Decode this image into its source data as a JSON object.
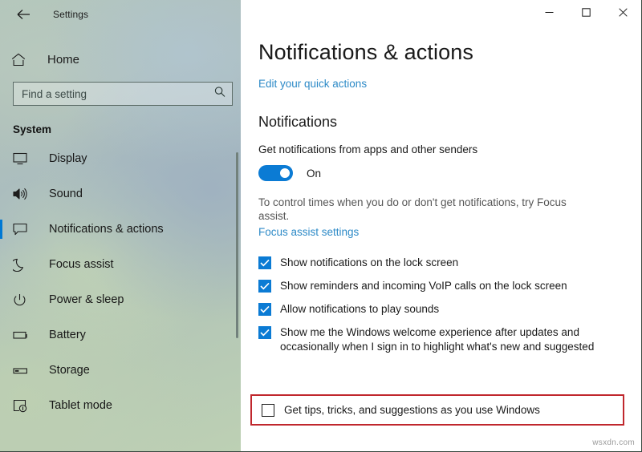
{
  "window": {
    "titlebar": {
      "back_label": "Back",
      "title": "Settings",
      "minimize_label": "Minimize",
      "maximize_label": "Maximize",
      "close_label": "Close"
    },
    "watermark": "wsxdn.com"
  },
  "sidebar": {
    "home": {
      "label": "Home",
      "icon": "home-icon"
    },
    "search": {
      "placeholder": "Find a setting",
      "value": "",
      "icon": "search-icon"
    },
    "group_title": "System",
    "selected_index": 2,
    "items": [
      {
        "label": "Display",
        "icon": "monitor-icon"
      },
      {
        "label": "Sound",
        "icon": "speaker-icon"
      },
      {
        "label": "Notifications & actions",
        "icon": "notification-bubble-icon"
      },
      {
        "label": "Focus assist",
        "icon": "moon-icon"
      },
      {
        "label": "Power & sleep",
        "icon": "power-icon"
      },
      {
        "label": "Battery",
        "icon": "battery-icon"
      },
      {
        "label": "Storage",
        "icon": "drive-icon"
      },
      {
        "label": "Tablet mode",
        "icon": "tablet-touch-icon"
      }
    ]
  },
  "main": {
    "page_title": "Notifications & actions",
    "quick_actions_link": "Edit your quick actions",
    "section_title": "Notifications",
    "toggle": {
      "caption": "Get notifications from apps and other senders",
      "state_label": "On",
      "checked": true
    },
    "focus_description": "To control times when you do or don't get notifications, try Focus assist.",
    "focus_link": "Focus assist settings",
    "checkboxes": [
      {
        "label": "Show notifications on the lock screen",
        "checked": true
      },
      {
        "label": "Show reminders and incoming VoIP calls on the lock screen",
        "checked": true
      },
      {
        "label": "Allow notifications to play sounds",
        "checked": true
      },
      {
        "label": "Show me the Windows welcome experience after updates and occasionally when I sign in to highlight what's new and suggested",
        "checked": true
      }
    ],
    "highlighted_checkbox": {
      "label": "Get tips, tricks, and suggestions as you use Windows",
      "checked": false
    }
  },
  "colors": {
    "accent": "#0b7bd4",
    "link": "#2d8ac7",
    "highlight_border": "#c0272d",
    "selected_indicator": "#0078d4"
  }
}
